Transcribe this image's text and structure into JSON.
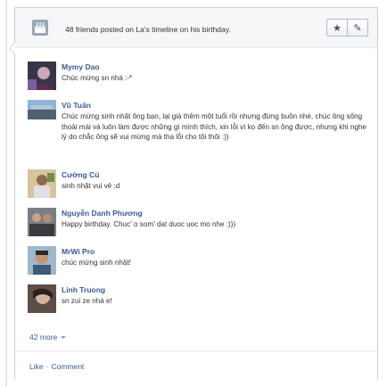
{
  "header": {
    "text": "48 friends posted on La's timeline on his birthday.",
    "star_button": "★",
    "edit_button": "✎"
  },
  "posts": [
    {
      "name": "Mymy Dao",
      "text": "Chúc mừng sn nhá :-*"
    },
    {
      "name": "Vũ Tuấn",
      "text": "Chúc mừng sinh nhật ông bạn, lại già thêm một tuổi rồi nhưng đừng buồn nhé, chúc ông sống thoải mái và luôn làm được những gì mình thích, xin lỗi vì ko đến sn ông được, nhưng khi nghe lý do chắc ông sẽ vui mừng mà tha lỗi cho tôi thôi :))"
    },
    {
      "name": "Cường Cú",
      "text": "sinh nhật vui vẻ :d"
    },
    {
      "name": "Nguyễn Danh Phương",
      "text": "Happy birthday. Chuc' o som' dat duoc uoc mo nhe :)))"
    },
    {
      "name": "MrWi Pro",
      "text": "chúc mừng sinh nhật!"
    },
    {
      "name": "Linh Truong",
      "text": "sn zui ze nhá e!"
    }
  ],
  "more": {
    "label": "42 more"
  },
  "footer": {
    "like": "Like",
    "separator": "·",
    "comment": "Comment"
  },
  "colors": {
    "link": "#3b5998",
    "border": "#c4cde0",
    "header_bg": "#f6f7f9"
  }
}
